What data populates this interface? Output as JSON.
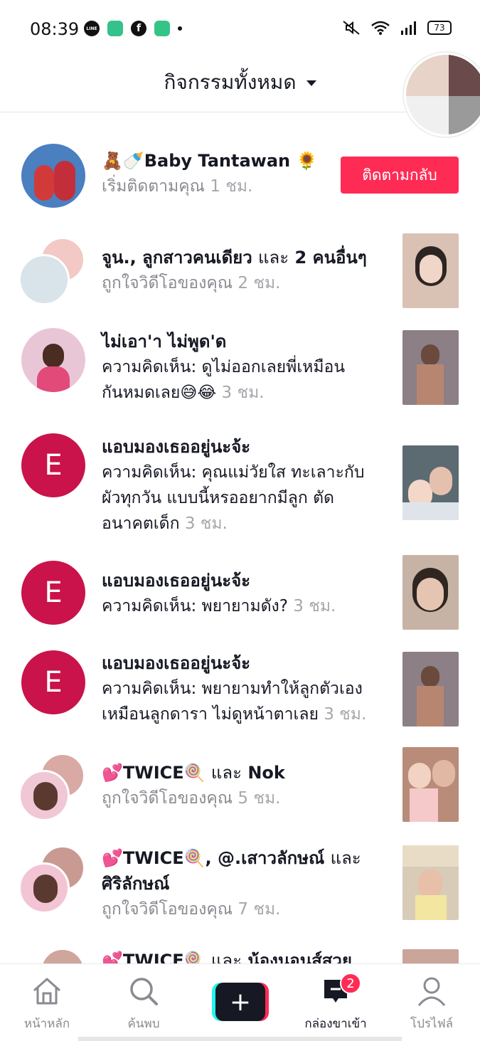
{
  "status_bar": {
    "time": "08:39",
    "apps": [
      {
        "icon": "line-icon",
        "label": "LINE",
        "color": "#111111"
      },
      {
        "icon": "app-square-icon",
        "label": "",
        "color": "#34c28a"
      },
      {
        "icon": "facebook-icon",
        "label": "f",
        "color": "#111111"
      },
      {
        "icon": "app-store-icon",
        "label": "",
        "color": "#35c487"
      }
    ],
    "battery": "73"
  },
  "header": {
    "title": "กิจกรรมทั้งหมด"
  },
  "notifications": [
    {
      "type": "follow",
      "name": "🧸🍼Baby Tantawan 🌻",
      "message": "เริ่มติดตามคุณ",
      "time": "1 ชม.",
      "button": "ติดตามกลับ",
      "avatar_color": "#4a7fc0"
    },
    {
      "type": "like",
      "name": "จูน., ลูกสาวคนเดียว",
      "and": "และ",
      "extra": "2 คนอื่นๆ",
      "message": "ถูกใจวิดีโอของคุณ",
      "time": "2 ชม.",
      "thumb_color": "#d9c2b4"
    },
    {
      "type": "comment",
      "name": "ไม่เอา'า ไม่พูด'ด",
      "message_lines": [
        "ความคิดเห็น: ดูไม่ออกเลยพี่เหมือน",
        "กันหมดเลย😅😂"
      ],
      "time": "3 ชม.",
      "avatar_color": "#c98ab0",
      "thumb_color": "#8c7f86"
    },
    {
      "type": "comment",
      "avatar_letter": "E",
      "name": "แอบมองเธออยู่นะจ้ะ",
      "message_lines": [
        "ความคิดเห็น: คุณแม่วัยใส ทะเลาะกับ",
        "ผัวทุกวัน แบบนี้หรออยากมีลูก ตัด",
        "อนาคตเด็ก"
      ],
      "time": "3 ชม.",
      "thumb_color": "#5c6a72"
    },
    {
      "type": "comment",
      "avatar_letter": "E",
      "name": "แอบมองเธออยู่นะจ้ะ",
      "message_lines": [
        "ความคิดเห็น: พยายามดัง?"
      ],
      "time": "3 ชม.",
      "thumb_color": "#c7b3a5"
    },
    {
      "type": "comment",
      "avatar_letter": "E",
      "name": "แอบมองเธออยู่นะจ้ะ",
      "message_lines": [
        "ความคิดเห็น: พยายามทำให้ลูกตัวเอง",
        "เหมือนลูกดารา ไม่ดูหน้าตาเลย"
      ],
      "time": "3 ชม.",
      "thumb_color": "#8c7f86"
    },
    {
      "type": "like",
      "name": "💕TWICE🍭",
      "and": "และ",
      "extra": "Nok",
      "message": "ถูกใจวิดีโอของคุณ",
      "time": "5 ชม.",
      "thumb_color": "#b88c78"
    },
    {
      "type": "like",
      "name": "💕TWICE🍭, @.เสาวลักษณ์",
      "and": "และ",
      "extra": "ศิริลักษณ์",
      "message": "ถูกใจวิดีโอของคุณ",
      "time": "7 ชม.",
      "thumb_color": "#d8cbb8"
    },
    {
      "type": "like",
      "name": "💕TWICE🍭",
      "and": "และ",
      "extra": "น้องนอนส์สวย",
      "message": "",
      "time": "",
      "thumb_color": "#caa59a"
    }
  ],
  "bottom_nav": {
    "home": "หน้าหลัก",
    "discover": "ค้นพบ",
    "create": "+",
    "inbox": "กล่องขาเข้า",
    "inbox_badge": "2",
    "profile": "โปรไฟล์"
  },
  "colors": {
    "accent": "#fe2c55",
    "avatar_letter_bg": "#c9134a",
    "create_cyan": "#25f4ee"
  }
}
